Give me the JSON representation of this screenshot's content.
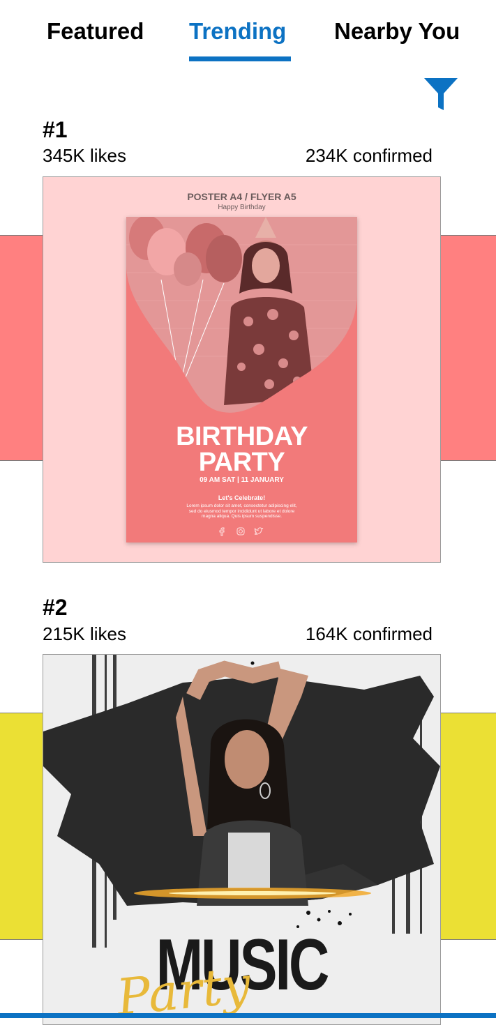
{
  "tabs": {
    "featured": "Featured",
    "trending": "Trending",
    "nearby": "Nearby You",
    "active": "Trending"
  },
  "colors": {
    "accent": "#0c72c3",
    "card1_band": "#ff8080",
    "card2_band": "#ebe034"
  },
  "cards": [
    {
      "rank": "#1",
      "likes": "345K likes",
      "confirmed": "234K confirmed",
      "poster": {
        "header": "POSTER A4 / FLYER A5",
        "header_sub": "Happy Birthday",
        "title_line1": "BIRTHDAY",
        "title_line2": "PARTY",
        "date": "09 AM SAT | 11 JANUARY",
        "tagline": "Let's Celebrate!",
        "body": "Lorem ipsum dolor sit amet, consectetur adipiscing elit, sed do eiusmod tempor incididunt ut labore et dolore magna aliqua. Quis ipsum suspendisse."
      }
    },
    {
      "rank": "#2",
      "likes": "215K likes",
      "confirmed": "164K confirmed",
      "poster": {
        "title": "MUSIC",
        "script": "Party"
      }
    }
  ]
}
